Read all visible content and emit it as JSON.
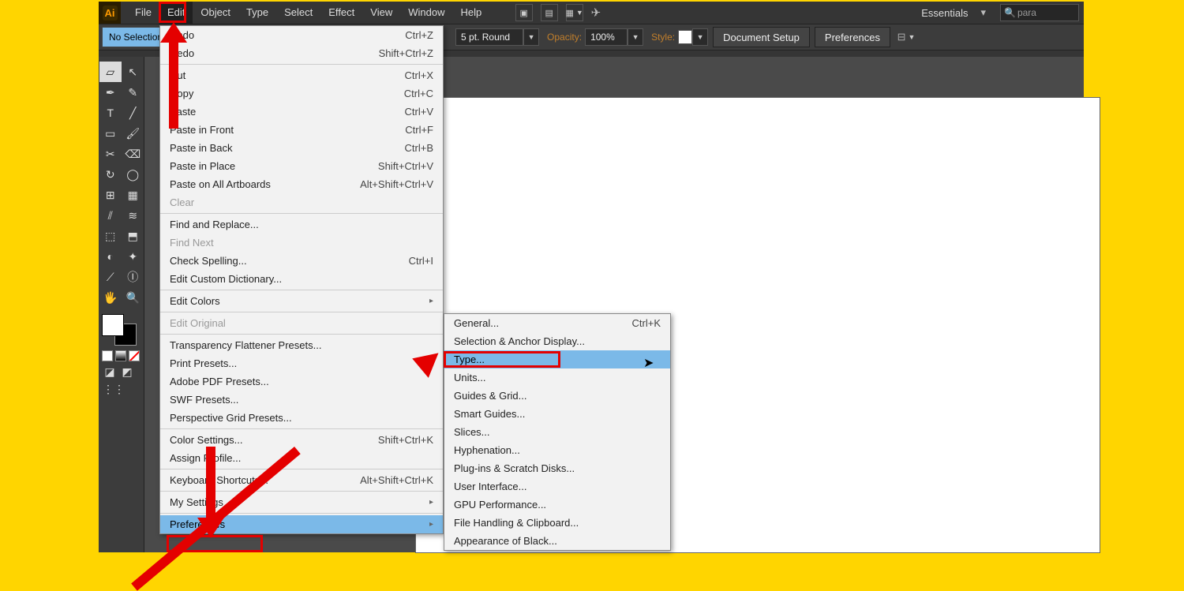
{
  "menubar": {
    "items": [
      "File",
      "Edit",
      "Object",
      "Type",
      "Select",
      "Effect",
      "View",
      "Window",
      "Help"
    ],
    "workspace": "Essentials",
    "search_placeholder": "para"
  },
  "controlbar": {
    "selection": "No Selection",
    "stroke_label": "",
    "brush": "5 pt. Round",
    "opacity_label": "Opacity:",
    "opacity_value": "100%",
    "style_label": "Style:",
    "doc_setup": "Document Setup",
    "preferences": "Preferences"
  },
  "edit_menu": [
    {
      "label": "Undo",
      "short": "Ctrl+Z"
    },
    {
      "label": "Redo",
      "short": "Shift+Ctrl+Z"
    },
    {
      "sep": true
    },
    {
      "label": "Cut",
      "short": "Ctrl+X"
    },
    {
      "label": "Copy",
      "short": "Ctrl+C"
    },
    {
      "label": "Paste",
      "short": "Ctrl+V"
    },
    {
      "label": "Paste in Front",
      "short": "Ctrl+F"
    },
    {
      "label": "Paste in Back",
      "short": "Ctrl+B"
    },
    {
      "label": "Paste in Place",
      "short": "Shift+Ctrl+V"
    },
    {
      "label": "Paste on All Artboards",
      "short": "Alt+Shift+Ctrl+V"
    },
    {
      "label": "Clear",
      "disabled": true
    },
    {
      "sep": true
    },
    {
      "label": "Find and Replace..."
    },
    {
      "label": "Find Next",
      "disabled": true
    },
    {
      "label": "Check Spelling...",
      "short": "Ctrl+I"
    },
    {
      "label": "Edit Custom Dictionary..."
    },
    {
      "sep": true
    },
    {
      "label": "Edit Colors",
      "child": true
    },
    {
      "sep": true
    },
    {
      "label": "Edit Original",
      "disabled": true
    },
    {
      "sep": true
    },
    {
      "label": "Transparency Flattener Presets..."
    },
    {
      "label": "Print Presets..."
    },
    {
      "label": "Adobe PDF Presets..."
    },
    {
      "label": "SWF Presets..."
    },
    {
      "label": "Perspective Grid Presets..."
    },
    {
      "sep": true
    },
    {
      "label": "Color Settings...",
      "short": "Shift+Ctrl+K"
    },
    {
      "label": "Assign Profile..."
    },
    {
      "sep": true
    },
    {
      "label": "Keyboard Shortcuts...",
      "short": "Alt+Shift+Ctrl+K"
    },
    {
      "sep": true
    },
    {
      "label": "My Settings",
      "child": true
    },
    {
      "sep": true
    },
    {
      "label": "Preferences",
      "child": true,
      "highlighted": true
    }
  ],
  "preferences_submenu": [
    {
      "label": "General...",
      "short": "Ctrl+K"
    },
    {
      "label": "Selection & Anchor Display..."
    },
    {
      "label": "Type...",
      "highlighted": true
    },
    {
      "label": "Units..."
    },
    {
      "label": "Guides & Grid..."
    },
    {
      "label": "Smart Guides..."
    },
    {
      "label": "Slices..."
    },
    {
      "label": "Hyphenation..."
    },
    {
      "label": "Plug-ins & Scratch Disks..."
    },
    {
      "label": "User Interface..."
    },
    {
      "label": "GPU Performance..."
    },
    {
      "label": "File Handling & Clipboard..."
    },
    {
      "label": "Appearance of Black..."
    }
  ],
  "tools": [
    [
      "▱",
      "↖"
    ],
    [
      "✒",
      "✎"
    ],
    [
      "T",
      "╱"
    ],
    [
      "▭",
      "🖌"
    ],
    [
      "✂",
      "⌫"
    ],
    [
      "↻",
      "◯"
    ],
    [
      "⊞",
      "▦"
    ],
    [
      "⫽",
      "≋"
    ],
    [
      "⬚",
      "⬒"
    ],
    [
      "◐",
      "✦"
    ],
    [
      "⟋",
      "Ⓘ"
    ],
    [
      "🖐",
      "🔍"
    ]
  ],
  "logo": "Ai"
}
